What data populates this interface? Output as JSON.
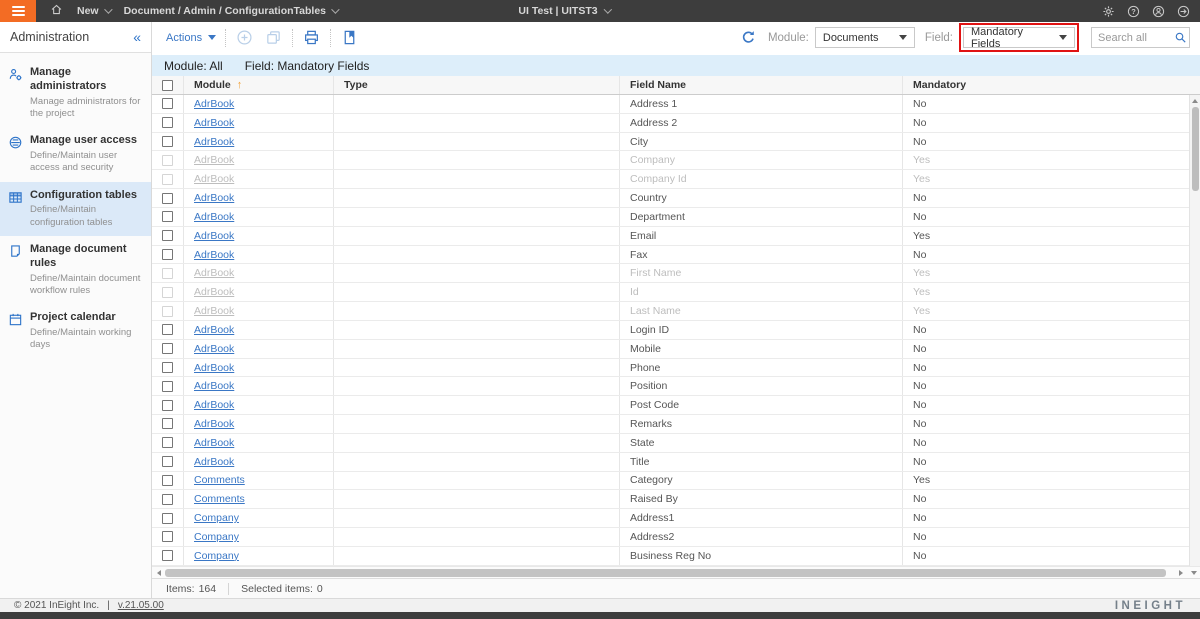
{
  "topbar": {
    "nav_new_label": "New",
    "breadcrumb": "Document / Admin / ConfigurationTables",
    "project_label": "UI Test | UITST3"
  },
  "sidebar": {
    "title": "Administration",
    "collapse_glyph": "«",
    "items": [
      {
        "label": "Manage administrators",
        "desc": "Manage administrators for the project",
        "icon": "manage-administrators-icon",
        "selected": false
      },
      {
        "label": "Manage user access",
        "desc": "Define/Maintain user access and security",
        "icon": "user-access-icon",
        "selected": false
      },
      {
        "label": "Configuration tables",
        "desc": "Define/Maintain configuration tables",
        "icon": "configuration-tables-icon",
        "selected": true
      },
      {
        "label": "Manage document rules",
        "desc": "Define/Maintain document workflow rules",
        "icon": "document-rules-icon",
        "selected": false
      },
      {
        "label": "Project calendar",
        "desc": "Define/Maintain working days",
        "icon": "calendar-icon",
        "selected": false
      }
    ]
  },
  "toolbar": {
    "actions_label": "Actions",
    "module_label": "Module:",
    "module_value": "Documents",
    "field_label": "Field:",
    "field_value": "Mandatory Fields",
    "search_placeholder": "Search all"
  },
  "grid": {
    "caption_module": "Module: All",
    "caption_field": "Field: Mandatory Fields",
    "columns": [
      "Module",
      "Type",
      "Field Name",
      "Mandatory"
    ],
    "sort_column": "Module",
    "sort_direction": "asc",
    "sort_indicator": "↑",
    "rows": [
      {
        "module": "AdrBook",
        "type": "",
        "field": "Address 1",
        "mandatory": "No",
        "disabled": false
      },
      {
        "module": "AdrBook",
        "type": "",
        "field": "Address 2",
        "mandatory": "No",
        "disabled": false
      },
      {
        "module": "AdrBook",
        "type": "",
        "field": "City",
        "mandatory": "No",
        "disabled": false
      },
      {
        "module": "AdrBook",
        "type": "",
        "field": "Company",
        "mandatory": "Yes",
        "disabled": true
      },
      {
        "module": "AdrBook",
        "type": "",
        "field": "Company Id",
        "mandatory": "Yes",
        "disabled": true
      },
      {
        "module": "AdrBook",
        "type": "",
        "field": "Country",
        "mandatory": "No",
        "disabled": false
      },
      {
        "module": "AdrBook",
        "type": "",
        "field": "Department",
        "mandatory": "No",
        "disabled": false
      },
      {
        "module": "AdrBook",
        "type": "",
        "field": "Email",
        "mandatory": "Yes",
        "disabled": false
      },
      {
        "module": "AdrBook",
        "type": "",
        "field": "Fax",
        "mandatory": "No",
        "disabled": false
      },
      {
        "module": "AdrBook",
        "type": "",
        "field": "First Name",
        "mandatory": "Yes",
        "disabled": true
      },
      {
        "module": "AdrBook",
        "type": "",
        "field": "Id",
        "mandatory": "Yes",
        "disabled": true
      },
      {
        "module": "AdrBook",
        "type": "",
        "field": "Last Name",
        "mandatory": "Yes",
        "disabled": true
      },
      {
        "module": "AdrBook",
        "type": "",
        "field": "Login ID",
        "mandatory": "No",
        "disabled": false
      },
      {
        "module": "AdrBook",
        "type": "",
        "field": "Mobile",
        "mandatory": "No",
        "disabled": false
      },
      {
        "module": "AdrBook",
        "type": "",
        "field": "Phone",
        "mandatory": "No",
        "disabled": false
      },
      {
        "module": "AdrBook",
        "type": "",
        "field": "Position",
        "mandatory": "No",
        "disabled": false
      },
      {
        "module": "AdrBook",
        "type": "",
        "field": "Post Code",
        "mandatory": "No",
        "disabled": false
      },
      {
        "module": "AdrBook",
        "type": "",
        "field": "Remarks",
        "mandatory": "No",
        "disabled": false
      },
      {
        "module": "AdrBook",
        "type": "",
        "field": "State",
        "mandatory": "No",
        "disabled": false
      },
      {
        "module": "AdrBook",
        "type": "",
        "field": "Title",
        "mandatory": "No",
        "disabled": false
      },
      {
        "module": "Comments",
        "type": "",
        "field": "Category",
        "mandatory": "Yes",
        "disabled": false
      },
      {
        "module": "Comments",
        "type": "",
        "field": "Raised By",
        "mandatory": "No",
        "disabled": false
      },
      {
        "module": "Company",
        "type": "",
        "field": "Address1",
        "mandatory": "No",
        "disabled": false
      },
      {
        "module": "Company",
        "type": "",
        "field": "Address2",
        "mandatory": "No",
        "disabled": false
      },
      {
        "module": "Company",
        "type": "",
        "field": "Business Reg No",
        "mandatory": "No",
        "disabled": false
      }
    ],
    "items_label": "Items:",
    "items_count": "164",
    "selected_label": "Selected items:",
    "selected_count": "0"
  },
  "footer": {
    "copyright": "© 2021 InEight Inc.",
    "divider": "|",
    "version_link": "v.21.05.00",
    "wordmark": "INEIGHT"
  },
  "colors": {
    "accent_orange": "#f36c24",
    "topbar_bg": "#3d3d3d",
    "link_blue": "#3a77c5",
    "icon_blue": "#2e74c9",
    "highlight_red": "#e01313",
    "caption_bg": "#ddeefa",
    "selected_item_bg": "#dbe9f8",
    "sort_arrow_orange": "#f2a23a"
  }
}
